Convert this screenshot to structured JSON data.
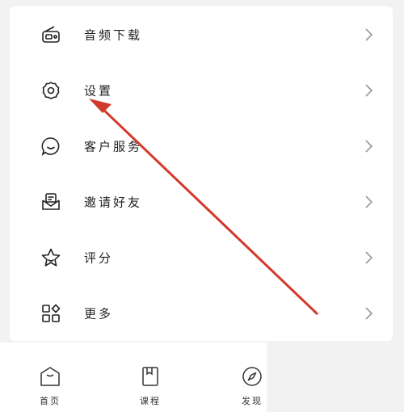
{
  "menu": {
    "items": [
      {
        "label": "音频下载",
        "icon": "radio-icon"
      },
      {
        "label": "设置",
        "icon": "gear-icon"
      },
      {
        "label": "客户服务",
        "icon": "chat-bubble-icon"
      },
      {
        "label": "邀请好友",
        "icon": "envelope-icon"
      },
      {
        "label": "评分",
        "icon": "star-icon"
      },
      {
        "label": "更多",
        "icon": "grid-icon"
      }
    ]
  },
  "tabbar": {
    "tabs": [
      {
        "label": "首页",
        "icon": "home-icon"
      },
      {
        "label": "课程",
        "icon": "book-icon"
      },
      {
        "label": "发现",
        "icon": "compass-icon"
      }
    ]
  },
  "annotation": {
    "arrow_color": "#d23a2a"
  }
}
